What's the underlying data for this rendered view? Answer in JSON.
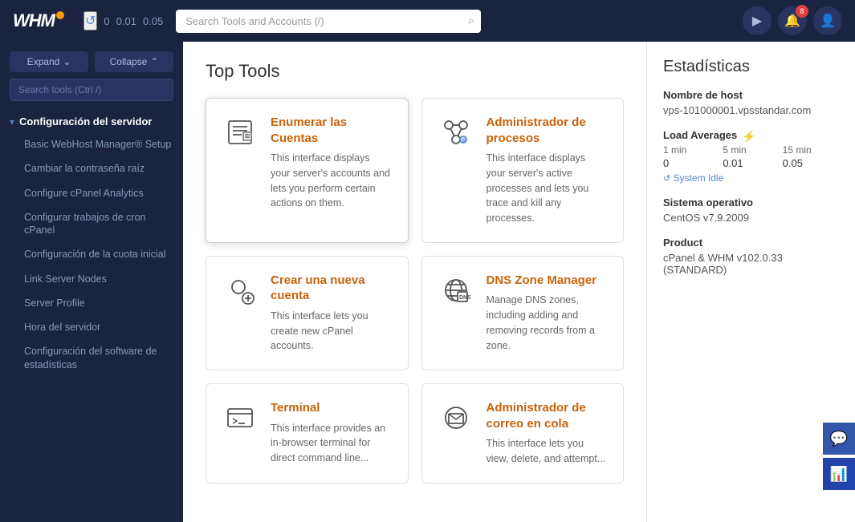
{
  "topbar": {
    "logo": "WHM",
    "refresh_icon": "↺",
    "load_0": "0",
    "load_1": "0.01",
    "load_2": "0.05",
    "search_placeholder": "Search Tools and Accounts (/)",
    "search_icon": "🔍",
    "media_btn_icon": "▶",
    "bell_btn_icon": "🔔",
    "bell_badge": "8",
    "user_btn_icon": "👤"
  },
  "sidebar": {
    "expand_label": "Expand",
    "collapse_label": "Collapse",
    "search_placeholder": "Search tools (Ctrl /)",
    "section_title": "Configuración del servidor",
    "section_arrow": "▾",
    "items": [
      {
        "label": "Basic WebHost Manager® Setup"
      },
      {
        "label": "Cambiar la contraseña raíz"
      },
      {
        "label": "Configure cPanel Analytics"
      },
      {
        "label": "Configurar trabajos de cron cPanel"
      },
      {
        "label": "Configuración de la cuota inicial"
      },
      {
        "label": "Link Server Nodes"
      },
      {
        "label": "Server Profile"
      },
      {
        "label": "Hora del servidor"
      },
      {
        "label": "Configuración del software de estadísticas"
      }
    ]
  },
  "main": {
    "section_title": "Top Tools",
    "tools": [
      {
        "id": "enumerar",
        "name": "Enumerar las Cuentas",
        "description": "This interface displays your server's accounts and lets you perform certain actions on them.",
        "icon": "list"
      },
      {
        "id": "procesos",
        "name": "Administrador de procesos",
        "description": "This interface displays your server's active processes and lets you trace and kill any processes.",
        "icon": "process"
      },
      {
        "id": "nueva-cuenta",
        "name": "Crear una nueva cuenta",
        "description": "This interface lets you create new cPanel accounts.",
        "icon": "add-user"
      },
      {
        "id": "dns",
        "name": "DNS Zone Manager",
        "description": "Manage DNS zones, including adding and removing records from a zone.",
        "icon": "dns"
      },
      {
        "id": "terminal",
        "name": "Terminal",
        "description": "This interface provides an in-browser terminal for direct command line...",
        "icon": "terminal"
      },
      {
        "id": "correo",
        "name": "Administrador de correo en cola",
        "description": "This interface lets you view, delete, and attempt...",
        "icon": "mail"
      }
    ]
  },
  "stats": {
    "title": "Estadísticas",
    "hostname_label": "Nombre de host",
    "hostname_value": "vps-101000001.vpsstandar.com",
    "load_label": "Load Averages",
    "load_icon": "⚡",
    "load_headers": [
      "1 min",
      "5 min",
      "15 min"
    ],
    "load_values": [
      "0",
      "0.01",
      "0.05"
    ],
    "system_idle_label": "System Idle",
    "system_idle_icon": "↺",
    "os_label": "Sistema operativo",
    "os_value": "CentOS v7.9.2009",
    "product_label": "Product",
    "product_value": "cPanel & WHM v102.0.33 (STANDARD)"
  },
  "right_actions": {
    "chat_icon": "💬",
    "chart_icon": "📊"
  },
  "icons": {
    "expand_arrow": "⌄",
    "collapse_arrow": "⌃",
    "search": "🔍",
    "refresh": "↺"
  }
}
